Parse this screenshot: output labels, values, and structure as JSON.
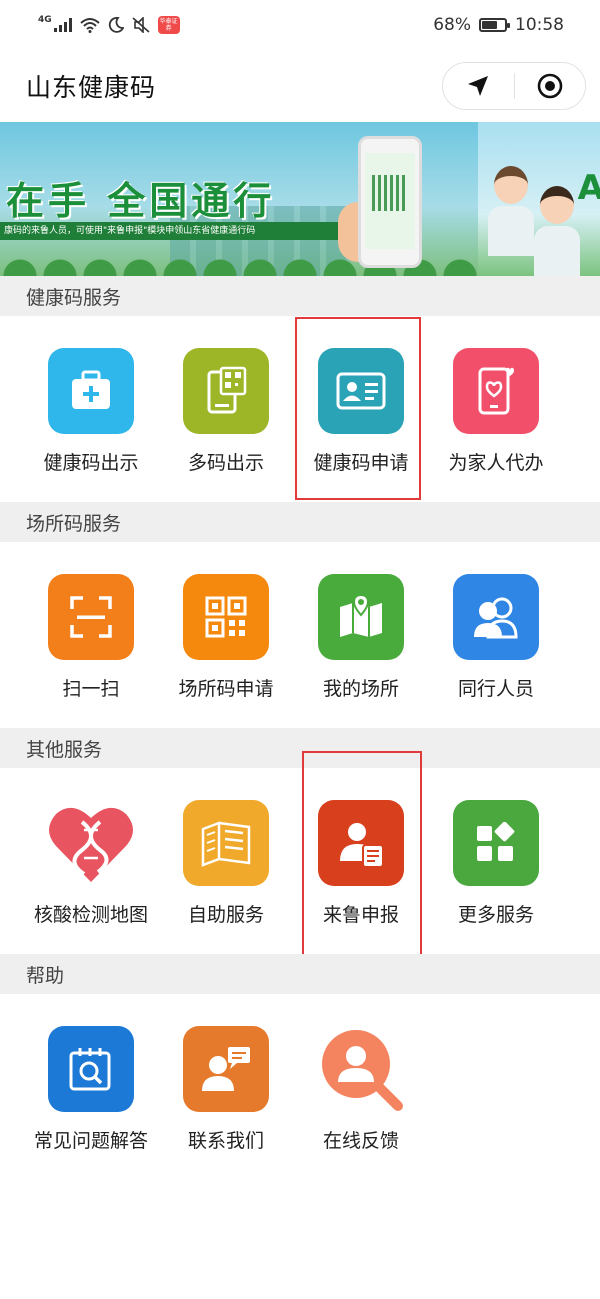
{
  "status_bar": {
    "network": "4G",
    "app_badge": "华泰证券",
    "battery_percent": "68%",
    "battery_level": 0.68,
    "time": "10:58"
  },
  "header": {
    "title": "山东健康码",
    "capsule_icons": [
      "location-arrow-icon",
      "target-icon"
    ]
  },
  "banner": {
    "headline": "在手  全国通行",
    "subtitle": "康码的来鲁人员，可使用\"来鲁申报\"模块申领山东省健康通行码",
    "next_slide_letter": "A"
  },
  "sections": [
    {
      "title": "健康码服务",
      "items": [
        {
          "label": "健康码出示",
          "icon": "medical-kit-icon",
          "color": "#2fb6ea"
        },
        {
          "label": "多码出示",
          "icon": "multi-code-phone-icon",
          "color": "#9cb627"
        },
        {
          "label": "健康码申请",
          "icon": "id-card-icon",
          "color": "#2aa3b6"
        },
        {
          "label": "为家人代办",
          "icon": "phone-heart-icon",
          "color": "#f2506a"
        }
      ]
    },
    {
      "title": "场所码服务",
      "items": [
        {
          "label": "扫一扫",
          "icon": "scan-icon",
          "color": "#f37f1a"
        },
        {
          "label": "场所码申请",
          "icon": "qr-code-icon",
          "color": "#f5890e"
        },
        {
          "label": "我的场所",
          "icon": "map-pin-icon",
          "color": "#4aab3d"
        },
        {
          "label": "同行人员",
          "icon": "people-icon",
          "color": "#2f86e4"
        }
      ]
    },
    {
      "title": "其他服务",
      "items": [
        {
          "label": "核酸检测地图",
          "icon": "dna-heart-icon",
          "color": "#e85560"
        },
        {
          "label": "自助服务",
          "icon": "self-service-book-icon",
          "color": "#f0a92a"
        },
        {
          "label": "来鲁申报",
          "icon": "person-report-icon",
          "color": "#d8401d"
        },
        {
          "label": "更多服务",
          "icon": "grid-more-icon",
          "color": "#4aa83f"
        }
      ]
    },
    {
      "title": "帮助",
      "items": [
        {
          "label": "常见问题解答",
          "icon": "faq-search-icon",
          "color": "#1c79d6"
        },
        {
          "label": "联系我们",
          "icon": "contact-chat-icon",
          "color": "#e67a2c"
        },
        {
          "label": "在线反馈",
          "icon": "feedback-search-icon",
          "color": "#f4845f"
        }
      ]
    }
  ]
}
